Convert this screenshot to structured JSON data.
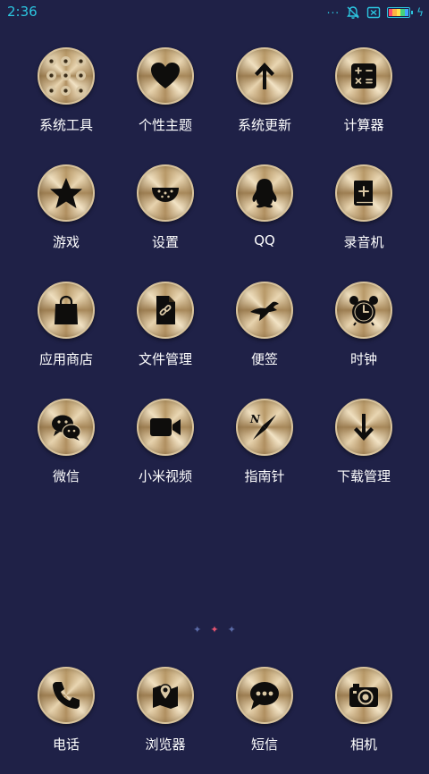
{
  "status_bar": {
    "time": "2:36",
    "overflow_dots": "...",
    "icons": [
      "notifications-muted-icon",
      "sim-off-icon",
      "battery-icon",
      "charging-icon"
    ],
    "accent_color": "#2cc6e0"
  },
  "apps": [
    {
      "label": "系统工具",
      "icon": "folder-icon"
    },
    {
      "label": "个性主题",
      "icon": "heart-icon"
    },
    {
      "label": "系统更新",
      "icon": "arrow-up-icon"
    },
    {
      "label": "计算器",
      "icon": "calculator-icon"
    },
    {
      "label": "游戏",
      "icon": "star-icon"
    },
    {
      "label": "设置",
      "icon": "watermelon-icon"
    },
    {
      "label": "QQ",
      "icon": "penguin-icon"
    },
    {
      "label": "录音机",
      "icon": "book-plus-icon"
    },
    {
      "label": "应用商店",
      "icon": "shopping-bag-icon"
    },
    {
      "label": "文件管理",
      "icon": "file-link-icon"
    },
    {
      "label": "便签",
      "icon": "bird-icon"
    },
    {
      "label": "时钟",
      "icon": "alarm-clock-icon"
    },
    {
      "label": "微信",
      "icon": "chat-bubbles-icon"
    },
    {
      "label": "小米视频",
      "icon": "video-camera-icon"
    },
    {
      "label": "指南针",
      "icon": "compass-icon"
    },
    {
      "label": "下载管理",
      "icon": "arrow-down-icon"
    }
  ],
  "page_indicator": {
    "symbols": [
      "✦",
      "✦",
      "✦"
    ],
    "active_index": 1
  },
  "dock": [
    {
      "label": "电话",
      "icon": "phone-icon"
    },
    {
      "label": "浏览器",
      "icon": "map-pin-icon"
    },
    {
      "label": "短信",
      "icon": "message-bubble-icon"
    },
    {
      "label": "相机",
      "icon": "camera-icon"
    }
  ]
}
